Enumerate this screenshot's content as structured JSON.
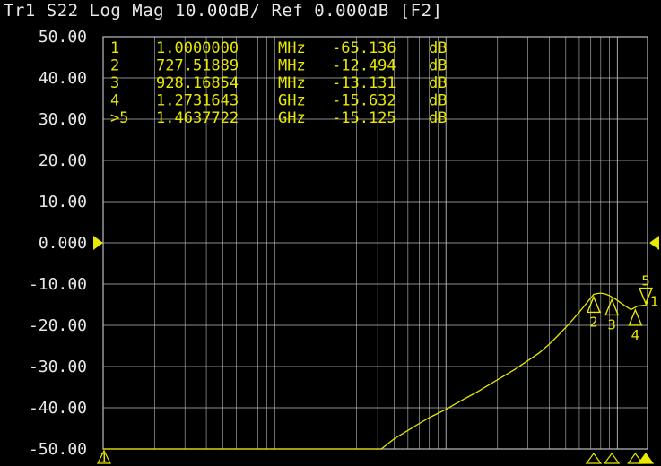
{
  "header": {
    "title": "Tr1 S22 Log Mag 10.00dB/ Ref 0.000dB [F2]"
  },
  "colors": {
    "background": "#000000",
    "grid": "#bdbdbd",
    "trace": "#e8e800",
    "text": "#e8e8e8"
  },
  "chart_data": {
    "type": "line",
    "title": "Tr1 S22 Log Mag 10.00dB/ Ref 0.000dB [F2]",
    "x_scale": "log",
    "x_unit": "MHz",
    "xlim": [
      1,
      1500
    ],
    "ylim": [
      -50,
      50
    ],
    "yticks": [
      "50.00",
      "40.00",
      "30.00",
      "20.00",
      "10.00",
      "0.000",
      "-10.00",
      "-20.00",
      "-30.00",
      "-40.00",
      "-50.00"
    ],
    "grid": true,
    "reference_level": 0.0,
    "series": [
      {
        "x": [
          1,
          5,
          10,
          20,
          40,
          42,
          45,
          50,
          60,
          70,
          80,
          100,
          120,
          150,
          200,
          250,
          300,
          350,
          400,
          450,
          500,
          550,
          600,
          650,
          700,
          727.51889,
          760,
          800,
          850,
          900,
          928.16854,
          980,
          1050,
          1120,
          1200,
          1273.1643,
          1300,
          1400,
          1463.7722,
          1500
        ],
        "y": [
          -50,
          -50,
          -50,
          -50,
          -50,
          -50,
          -49,
          -47.5,
          -45.5,
          -43.8,
          -42.4,
          -40.4,
          -38.5,
          -36.3,
          -33.2,
          -30.8,
          -28.6,
          -26.7,
          -24.6,
          -22.5,
          -20.5,
          -18.6,
          -16.8,
          -15.0,
          -13.4,
          -12.494,
          -12.3,
          -12.2,
          -12.4,
          -12.8,
          -13.131,
          -13.7,
          -14.6,
          -15.4,
          -16.2,
          -15.632,
          -15.4,
          -15.2,
          -15.125,
          -14.0
        ]
      }
    ],
    "markers": [
      {
        "label": "1",
        "freq": "1.0000000",
        "unit": "MHz",
        "value": "-65.136",
        "value_unit": "dB",
        "x": 1,
        "y": -65.136
      },
      {
        "label": "2",
        "freq": "727.51889",
        "unit": "MHz",
        "value": "-12.494",
        "value_unit": "dB",
        "x": 727.51889,
        "y": -12.494
      },
      {
        "label": "3",
        "freq": "928.16854",
        "unit": "MHz",
        "value": "-13.131",
        "value_unit": "dB",
        "x": 928.16854,
        "y": -13.131
      },
      {
        "label": "4",
        "freq": "1.2731643",
        "unit": "GHz",
        "value": "-15.632",
        "value_unit": "dB",
        "x": 1273.1643,
        "y": -15.632
      },
      {
        "label": ">5",
        "freq": "1.4637722",
        "unit": "GHz",
        "value": "-15.125",
        "value_unit": "dB",
        "x": 1463.7722,
        "y": -15.125,
        "active": true
      }
    ]
  }
}
